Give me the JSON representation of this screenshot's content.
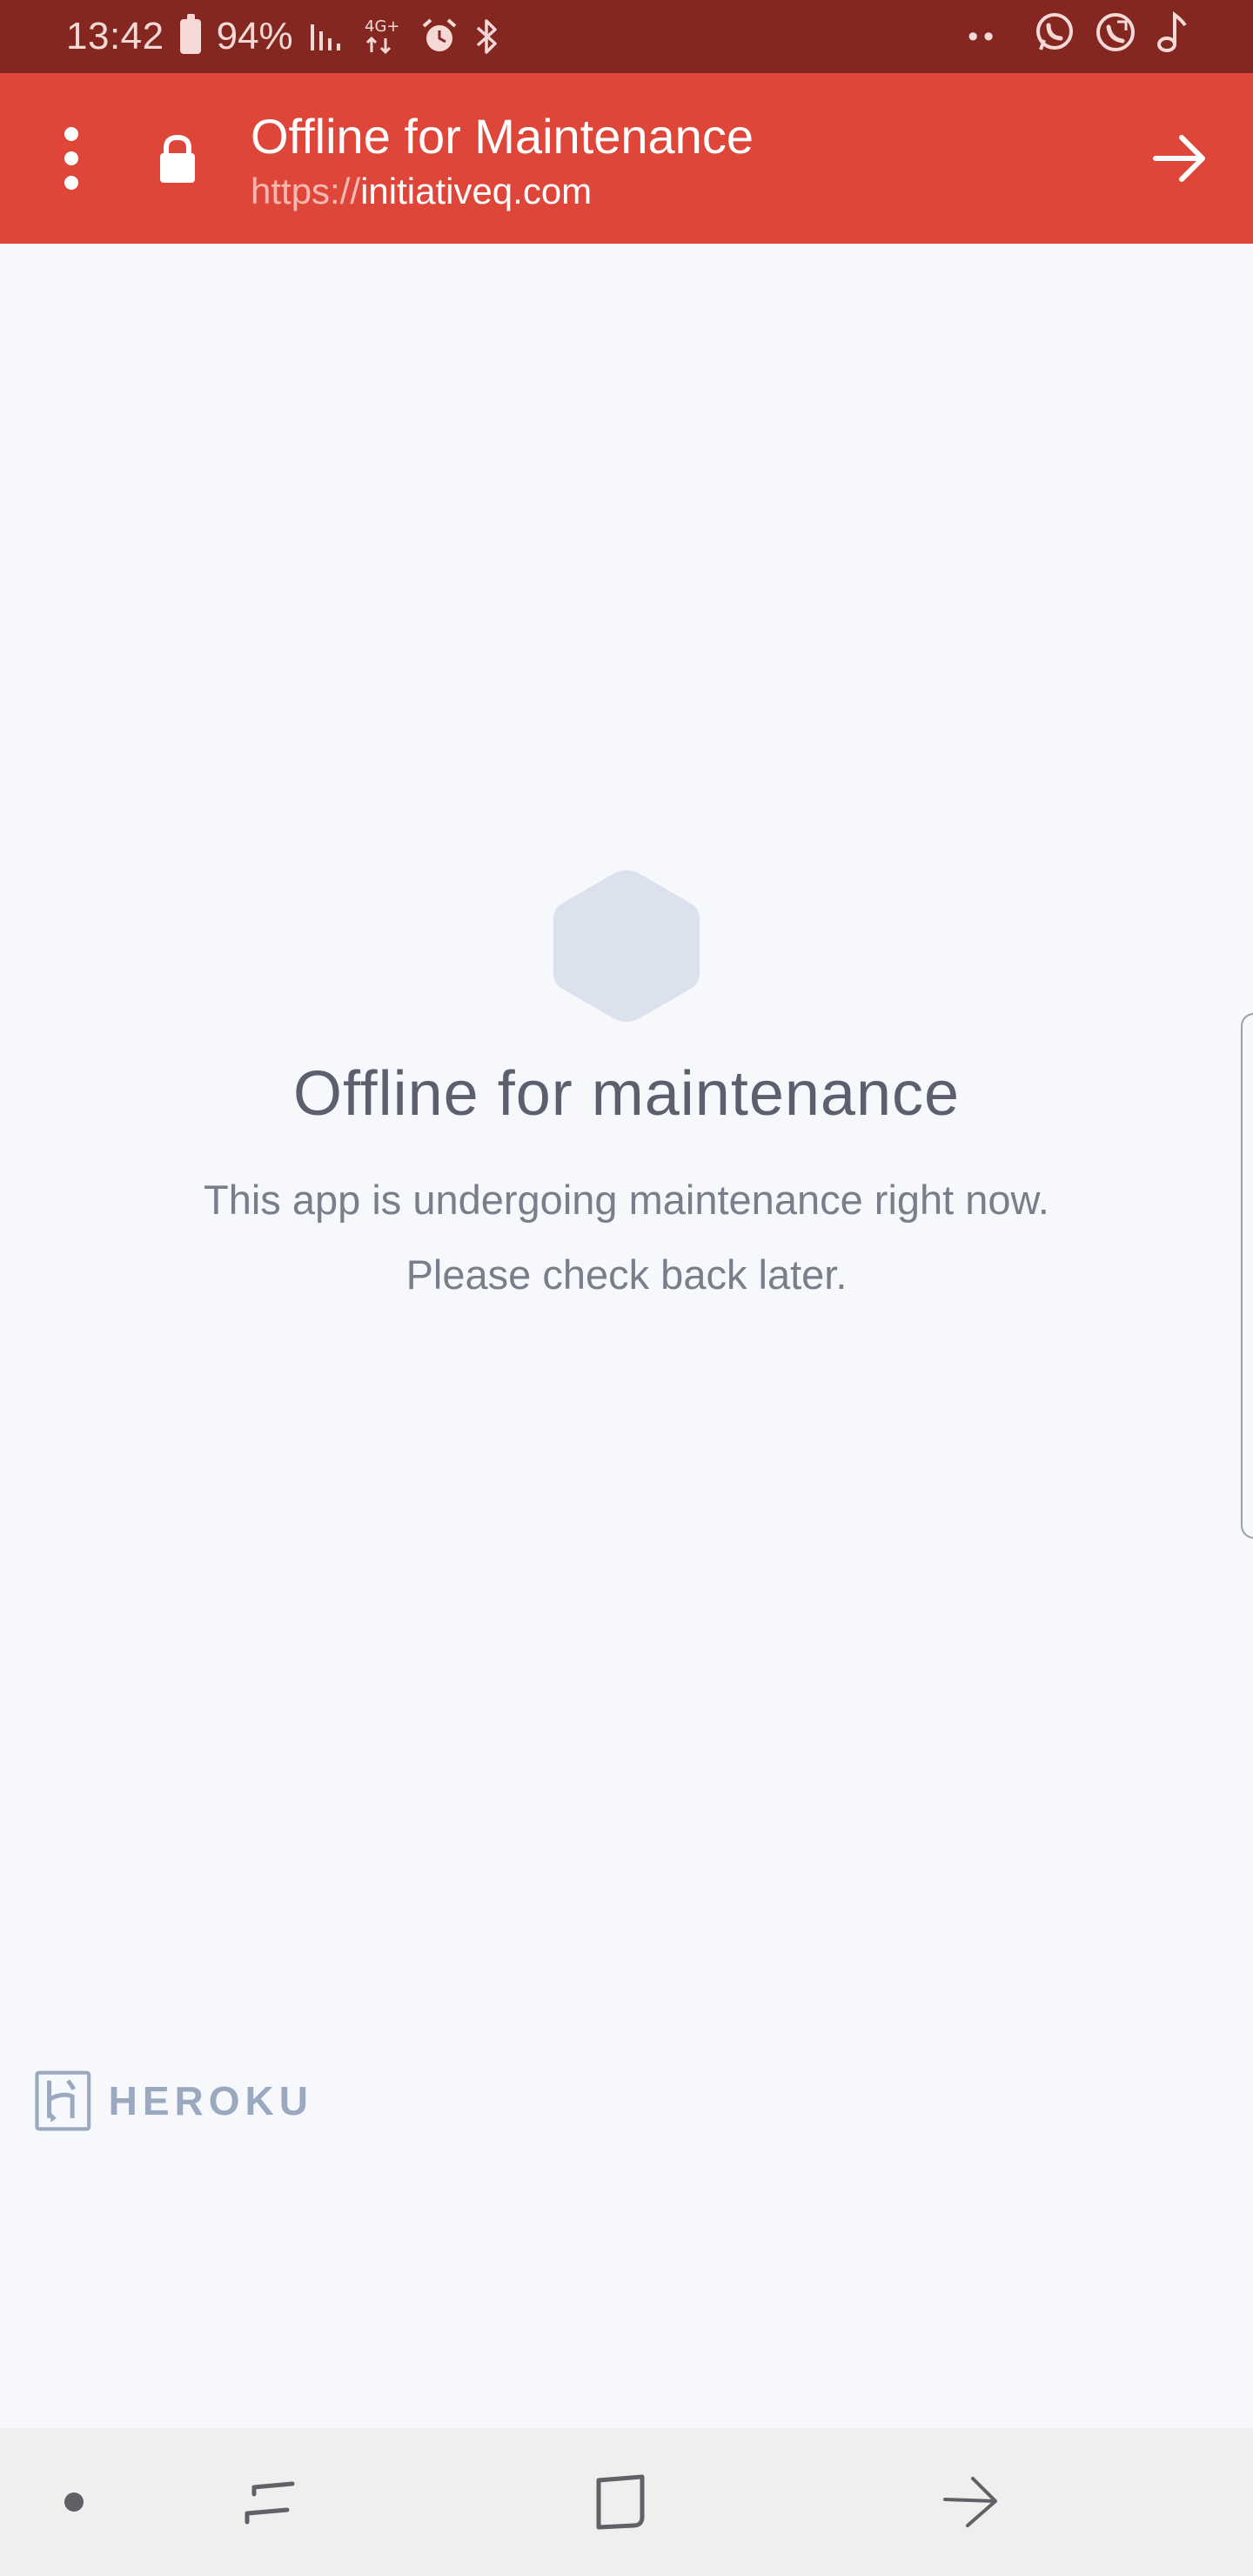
{
  "status_bar": {
    "time": "13:42",
    "battery": "94%",
    "network": "4G+",
    "icons": [
      "battery-icon",
      "signal-icon",
      "network-4g-icon",
      "alarm-icon",
      "bluetooth-icon",
      "more-dots-icon",
      "whatsapp-icon",
      "call-icon",
      "music-note-icon"
    ]
  },
  "toolbar": {
    "title": "Offline for Maintenance",
    "url_scheme": "https://",
    "url_host": "initiativeq.com",
    "colors": {
      "background": "#df463a",
      "status_bar": "#832720"
    }
  },
  "main": {
    "heading": "Offline for maintenance",
    "message_line1": "This app is undergoing maintenance right now.",
    "message_line2": "Please check back later."
  },
  "footer": {
    "brand": "HEROKU"
  },
  "nav_bar": {
    "buttons": [
      "nav-dot",
      "recents-button",
      "home-button",
      "back-button"
    ]
  }
}
